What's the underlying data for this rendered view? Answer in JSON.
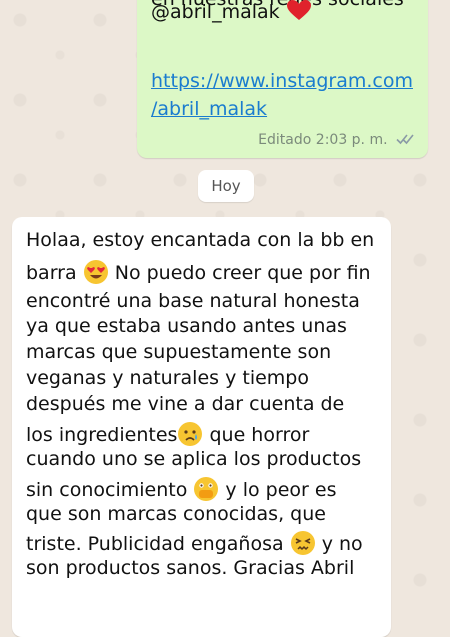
{
  "outgoing_message": {
    "lines": [
      "en nuestras redes sociales",
      "@abril_malak"
    ],
    "heart_emoji": "red-heart",
    "link_lines": [
      "https://www.instagram.com",
      "/abril_malak"
    ],
    "edited_label": "Editado",
    "time": "2:03 p. m.",
    "status_icon": "double-check-icon"
  },
  "date_divider": "Hoy",
  "incoming_message": {
    "lines": [
      "Holaa, estoy encantada con la bb en",
      "barra",
      "No puedo creer que por fin",
      "encontré una base natural honesta",
      "ya que estaba usando antes unas",
      "marcas que supuestamente son",
      "veganas y naturales y tiempo",
      "después me vine a dar cuenta de",
      "los ingredientes",
      "que horror",
      "cuando uno se aplica los productos",
      "sin conocimiento",
      "y lo peor es",
      "que son marcas conocidas, que",
      "triste. Publicidad engañosa",
      "y no",
      "son productos sanos. Gracias Abril"
    ],
    "emojis": [
      "heart-eyes-emoji",
      "sad-tear-emoji",
      "face-with-hand-over-mouth-emoji",
      "persevering-face-emoji"
    ]
  },
  "colors": {
    "wallpaper": "#efe7de",
    "outgoing_bubble": "#dcf8c6",
    "incoming_bubble": "#ffffff",
    "link": "#1a7ccf",
    "read_check": "#8a9aa6"
  }
}
